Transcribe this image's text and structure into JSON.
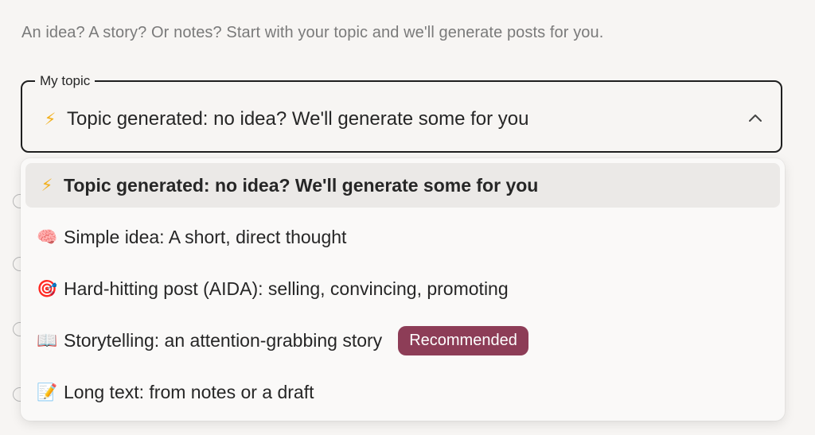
{
  "intro_text": "An idea? A story? Or notes? Start with your topic and we'll generate posts for you.",
  "topic_field": {
    "legend": "My topic",
    "value_icon": "lightning-emoji",
    "value_text": "Topic generated: no idea? We'll generate some for you",
    "expanded": true
  },
  "options": [
    {
      "icon": "lightning-emoji",
      "icon_glyph": "⚡",
      "label": "Topic generated: no idea? We'll generate some for you",
      "selected": true
    },
    {
      "icon": "brain-emoji",
      "icon_glyph": "🧠",
      "label": "Simple idea: A short, direct thought",
      "selected": false
    },
    {
      "icon": "target-emoji",
      "icon_glyph": "🎯",
      "label": "Hard-hitting post (AIDA): selling, convincing, promoting",
      "selected": false
    },
    {
      "icon": "open-book-emoji",
      "icon_glyph": "📖",
      "label": "Storytelling: an attention-grabbing story",
      "badge": "Recommended",
      "selected": false
    },
    {
      "icon": "memo-emoji",
      "icon_glyph": "📝",
      "label": "Long text: from notes or a draft",
      "selected": false
    }
  ],
  "colors": {
    "badge_bg": "#8d3d57",
    "selected_bg": "#ebe9e7",
    "border": "#1f1f1f",
    "background": "#f7f5f3"
  }
}
